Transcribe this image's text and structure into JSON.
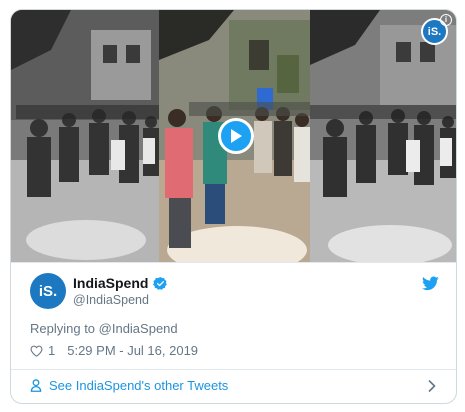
{
  "media": {
    "badge_text": "iS.",
    "info_icon": "i",
    "play_icon": "play-icon"
  },
  "author": {
    "avatar_text": "iS.",
    "display_name": "IndiaSpend",
    "handle": "@IndiaSpend",
    "verified_icon": "verified-badge-icon"
  },
  "tweet": {
    "replying_to": "Replying to @IndiaSpend",
    "like_count": "1",
    "timestamp": "5:29 PM - Jul 16, 2019"
  },
  "footer": {
    "link_text": "See IndiaSpend's other Tweets"
  },
  "colors": {
    "brand_blue": "#1c78c0",
    "twitter_blue": "#1da1f2",
    "link_blue": "#1b95e0",
    "secondary_text": "#657786",
    "border": "#cfd9de"
  }
}
